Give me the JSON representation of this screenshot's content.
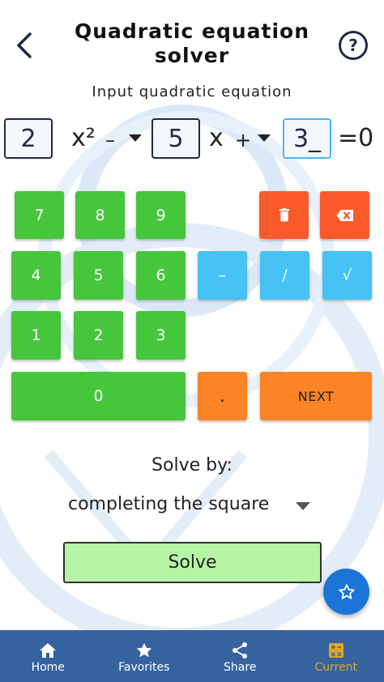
{
  "header": {
    "title": "Quadratic equation solver",
    "back_icon": "arrow-left-icon",
    "help_label": "?"
  },
  "subtitle": "Input quadratic equation",
  "equation": {
    "a": "2",
    "x2": "x²",
    "sign1": "–",
    "b": "5",
    "x": "x",
    "sign2": "+",
    "c": "3_",
    "equals_zero": "=0"
  },
  "keypad": {
    "digits": [
      "7",
      "8",
      "9",
      "4",
      "5",
      "6",
      "1",
      "2",
      "3",
      "0"
    ],
    "minus": "–",
    "divide": "/",
    "sqrt": "√",
    "dot": ".",
    "next": "NEXT",
    "delete_icon": "trash-icon",
    "backspace_icon": "backspace-icon"
  },
  "solve": {
    "solve_by_label": "Solve by:",
    "method": "completing the square",
    "button_label": "Solve"
  },
  "nav": {
    "items": [
      {
        "label": "Home",
        "icon": "home-icon"
      },
      {
        "label": "Favorites",
        "icon": "star-icon"
      },
      {
        "label": "Share",
        "icon": "share-icon"
      },
      {
        "label": "Current",
        "icon": "calculator-icon"
      }
    ],
    "active_index": 3
  },
  "colors": {
    "green": "#46c63b",
    "blue": "#46c2f5",
    "red": "#fa5a2a",
    "orange": "#fb8426",
    "nav_bg": "#3563a0",
    "nav_active": "#e3a62a",
    "fab": "#1d74d8"
  }
}
